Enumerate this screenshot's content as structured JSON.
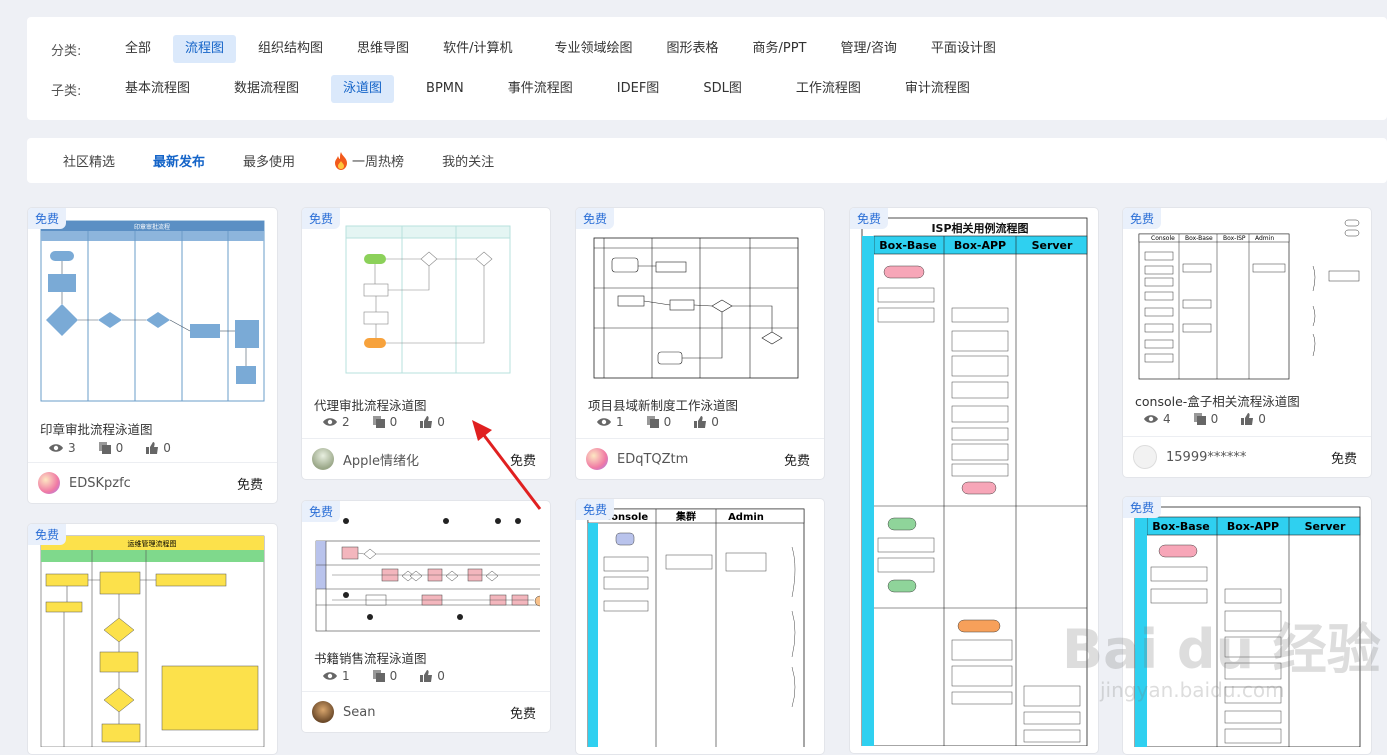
{
  "categories": {
    "label": "分类:",
    "items": [
      "全部",
      "流程图",
      "组织结构图",
      "思维导图",
      "软件/计算机",
      "专业领域绘图",
      "图形表格",
      "商务/PPT",
      "管理/咨询",
      "平面设计图"
    ],
    "active_index": 1
  },
  "subcategories": {
    "label": "子类:",
    "items": [
      "基本流程图",
      "数据流程图",
      "泳道图",
      "BPMN",
      "事件流程图",
      "IDEF图",
      "SDL图",
      "工作流程图",
      "审计流程图"
    ],
    "active_index": 2
  },
  "tabs": {
    "items": [
      "社区精选",
      "最新发布",
      "最多使用",
      "一周热榜",
      "我的关注"
    ],
    "active_index": 1
  },
  "cards": [
    {
      "badge": "免费",
      "title": "印章审批流程泳道图",
      "views": "3",
      "copies": "0",
      "likes": "0",
      "author": "EDSKpzfc",
      "price": "免费"
    },
    {
      "badge": "免费",
      "title": "代理审批流程泳道图",
      "views": "2",
      "copies": "0",
      "likes": "0",
      "author": "Apple情绪化",
      "price": "免费"
    },
    {
      "badge": "免费",
      "title": "项目县域新制度工作泳道图",
      "views": "1",
      "copies": "0",
      "likes": "0",
      "author": "EDqTQZtm",
      "price": "免费"
    },
    {
      "badge": "免费"
    },
    {
      "badge": "免费",
      "title": "console-盒子相关流程泳道图",
      "views": "4",
      "copies": "0",
      "likes": "0",
      "author": "15999******",
      "price": "免费"
    },
    {
      "badge": "免费"
    },
    {
      "badge": "免费",
      "title": "书籍销售流程泳道图",
      "views": "1",
      "copies": "0",
      "likes": "0",
      "author": "Sean",
      "price": "免费"
    },
    {
      "badge": "免费"
    },
    {
      "badge": "免费"
    }
  ],
  "thumbs": {
    "isp_title": "ISP相关用例流程图",
    "isp_cols": [
      "Box-Base",
      "Box-APP",
      "Server"
    ],
    "console_cols": [
      "Console",
      "Box-Base",
      "Box-ISP",
      "Admin"
    ],
    "console_cols2": [
      "Console",
      "集群",
      "Admin"
    ],
    "card1_title": "印章审批流程",
    "card5_title": "运维管理流程图"
  },
  "colors": {
    "accent": "#1464c8",
    "active_bg": "#dbe9fb",
    "badge_text": "#2a6ed6",
    "badge_bg": "#e9f0fb",
    "arrow": "#e02020"
  }
}
